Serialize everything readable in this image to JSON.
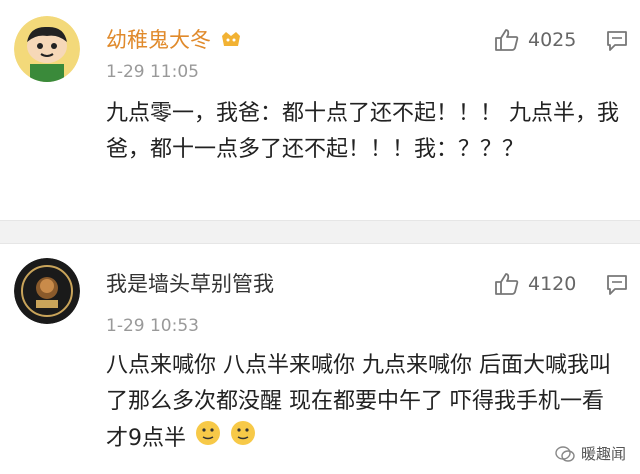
{
  "comments": [
    {
      "username": "幼稚鬼大冬",
      "time": "1-29 11:05",
      "likes": "4025",
      "text": "九点零一，我爸：都十点了还不起！！！ 九点半，我爸，都十一点多了还不起！！！我：？？？"
    },
    {
      "username": "我是墙头草别管我",
      "time": "1-29 10:53",
      "likes": "4120",
      "text": "八点来喊你 八点半来喊你 九点来喊你 后面大喊我叫了那么多次都没醒 现在都要中午了 吓得我手机一看 才9点半"
    }
  ],
  "watermark": "暖趣闻",
  "colors": {
    "username_highlight": "#e08a2b",
    "meta": "#999999",
    "text": "#222222"
  },
  "icons": [
    "thumbs-up-icon",
    "reply-icon",
    "vip-badge-icon",
    "emoji-face-icon",
    "wechat-logo-icon"
  ]
}
